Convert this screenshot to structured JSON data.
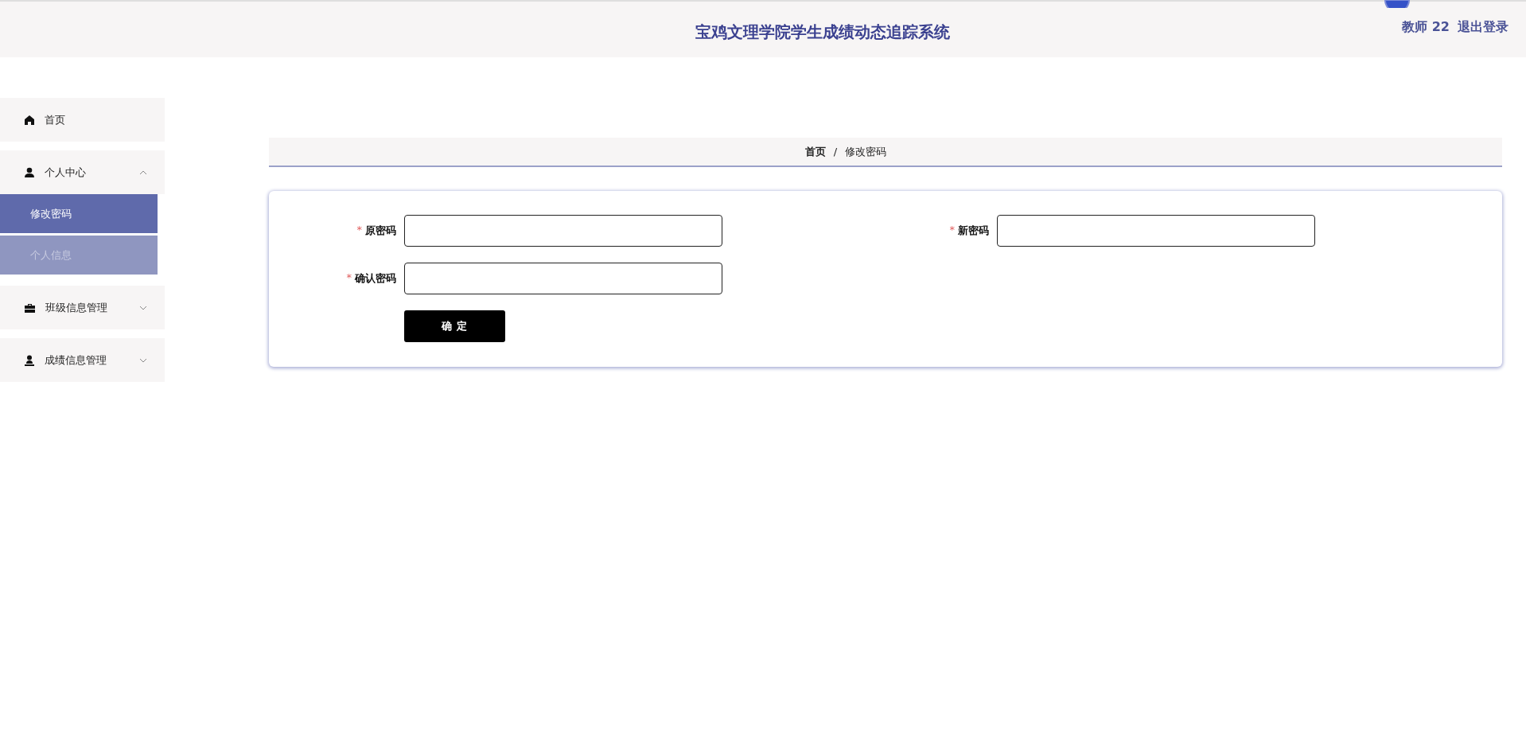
{
  "header": {
    "title": "宝鸡文理学院学生成绩动态追踪系统",
    "user": "教师 22",
    "logout": "退出登录"
  },
  "sidebar": {
    "items": [
      {
        "kind": "link",
        "label": "首页"
      },
      {
        "kind": "group",
        "label": "个人中心",
        "expanded": true,
        "children": [
          {
            "label": "修改密码",
            "selected": true
          },
          {
            "label": "个人信息",
            "selected": false
          }
        ]
      },
      {
        "kind": "group",
        "label": "班级信息管理",
        "expanded": false
      },
      {
        "kind": "group",
        "label": "成绩信息管理",
        "expanded": false
      }
    ]
  },
  "breadcrumb": {
    "items": [
      "首页",
      "修改密码"
    ],
    "separator": "/"
  },
  "form": {
    "fields": [
      {
        "label": "原密码",
        "required_mark": "*"
      },
      {
        "label": "新密码",
        "required_mark": "*"
      },
      {
        "label": "确认密码",
        "required_mark": "*"
      }
    ],
    "submit": "确 定"
  }
}
